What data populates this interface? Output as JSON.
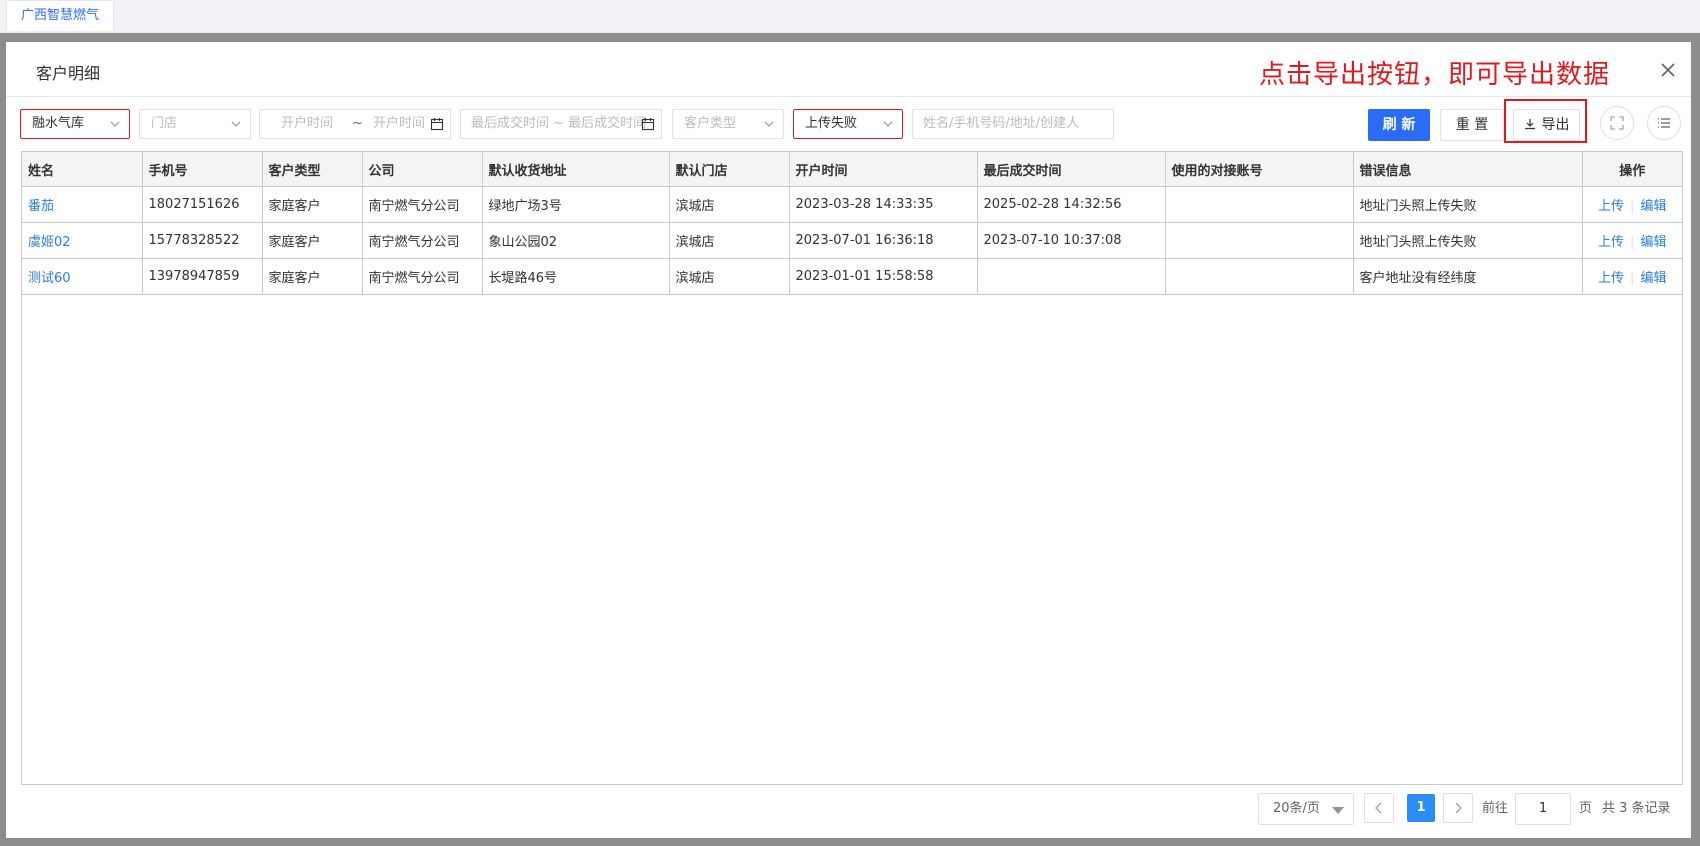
{
  "top": {
    "tab_label": "广西智慧燃气"
  },
  "dialog": {
    "title": "客户明细",
    "annotation": "点击导出按钮，即可导出数据"
  },
  "filters": {
    "warehouse": "融水气库",
    "store_placeholder": "门店",
    "open_start_placeholder": "开户时间",
    "range_sep": "~",
    "open_end_placeholder": "开户时间",
    "last_deal_placeholder": "最后成交时间 ~ 最后成交时间",
    "customer_type_placeholder": "客户类型",
    "upload_status": "上传失败",
    "search_placeholder": "姓名/手机号码/地址/创建人"
  },
  "actions": {
    "refresh_label": "刷 新",
    "reset_label": "重 置",
    "export_label": "导出"
  },
  "table": {
    "columns": [
      "姓名",
      "手机号",
      "客户类型",
      "公司",
      "默认收货地址",
      "默认门店",
      "开户时间",
      "最后成交时间",
      "使用的对接账号",
      "错误信息",
      "操作"
    ],
    "rows": [
      {
        "name": "番茄",
        "phone": "18027151626",
        "type": "家庭客户",
        "company": "南宁燃气分公司",
        "address": "绿地广场3号",
        "store": "滨城店",
        "open_time": "2023-03-28 14:33:35",
        "last_deal": "2025-02-28 14:32:56",
        "account": "",
        "error": "地址门头照上传失败",
        "op_upload": "上传",
        "op_edit": "编辑"
      },
      {
        "name": "虞姬02",
        "phone": "15778328522",
        "type": "家庭客户",
        "company": "南宁燃气分公司",
        "address": "象山公园02",
        "store": "滨城店",
        "open_time": "2023-07-01 16:36:18",
        "last_deal": "2023-07-10 10:37:08",
        "account": "",
        "error": "地址门头照上传失败",
        "op_upload": "上传",
        "op_edit": "编辑"
      },
      {
        "name": "测试60",
        "phone": "13978947859",
        "type": "家庭客户",
        "company": "南宁燃气分公司",
        "address": "长堤路46号",
        "store": "滨城店",
        "open_time": "2023-01-01 15:58:58",
        "last_deal": "",
        "account": "",
        "error": "客户地址没有经纬度",
        "op_upload": "上传",
        "op_edit": "编辑"
      }
    ]
  },
  "pagination": {
    "page_size": "20条/页",
    "current_page": "1",
    "goto_label": "前往",
    "goto_value": "1",
    "page_unit": "页",
    "total": "共 3 条记录"
  },
  "colors": {
    "primary": "#2a6cf6",
    "highlight_red": "#e0191f",
    "link": "#2a7de1",
    "pager_active": "#2a8cf7"
  }
}
